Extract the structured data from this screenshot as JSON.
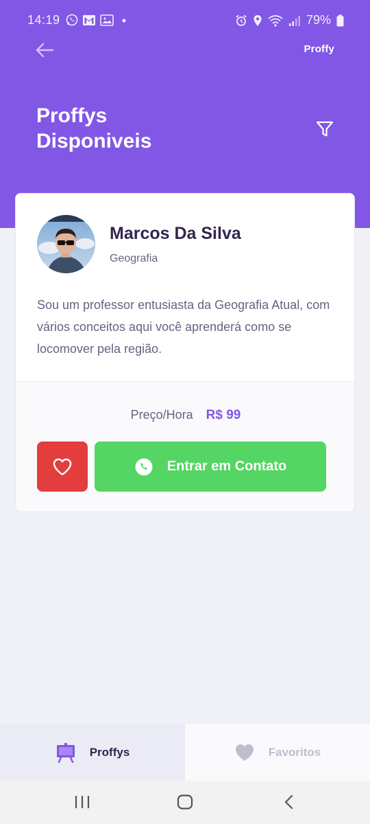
{
  "status_bar": {
    "time": "14:19",
    "battery": "79%",
    "left_icons": [
      "whatsapp-icon",
      "gmail-icon",
      "gallery-icon",
      "dot-icon"
    ],
    "right_icons": [
      "alarm-icon",
      "location-icon",
      "wifi-icon",
      "signal-icon",
      "battery-icon"
    ]
  },
  "header": {
    "brand": "Proffy",
    "title_line1": "Proffys",
    "title_line2": "Disponiveis",
    "back_icon": "arrow-left-icon",
    "filter_icon": "filter-icon"
  },
  "teacher_card": {
    "name": "Marcos Da Silva",
    "subject": "Geografia",
    "bio": "Sou um professor entusiasta da Geografia Atual, com vários conceitos aqui você aprenderá como se locomover pela região.",
    "price_label": "Preço/Hora",
    "price_value": "R$ 99",
    "contact_label": "Entrar em Contato",
    "favorite_icon": "heart-outline-icon",
    "contact_icon": "whatsapp-icon"
  },
  "tabs": [
    {
      "label": "Proffys",
      "icon": "easel-icon",
      "active": true
    },
    {
      "label": "Favoritos",
      "icon": "heart-icon",
      "active": false
    }
  ],
  "colors": {
    "primary": "#8257E5",
    "background": "#F0F0F7",
    "favorite": "#E33D3D",
    "contact": "#55D563",
    "title_text": "#32264D",
    "body_text": "#6A6180",
    "inactive_tab": "#C1BCCC"
  }
}
